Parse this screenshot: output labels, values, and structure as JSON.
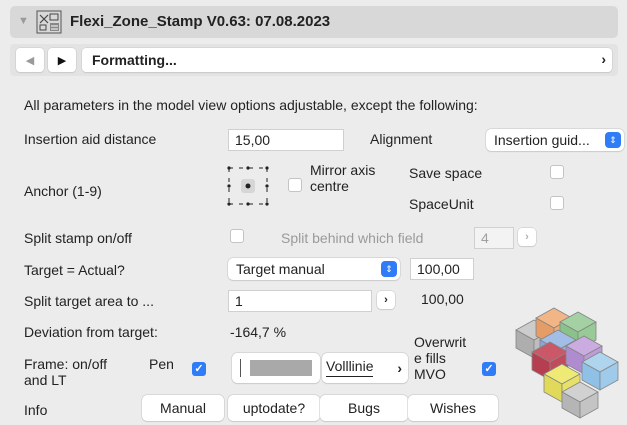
{
  "header": {
    "title": "Flexi_Zone_Stamp V0.63: 07.08.2023",
    "icon": "zone-stamp-object-icon",
    "collapse_icon": "disclosure-triangle-icon"
  },
  "nav": {
    "prev_icon": "triangle-left-icon",
    "next_icon": "triangle-right-icon",
    "page_label": "Formatting...",
    "page_chevron": "›"
  },
  "intro": "All parameters in the model view options adjustable, except the following:",
  "rows": {
    "insertion": {
      "label": "Insertion aid distance",
      "value": "15,00",
      "alignment_label": "Alignment",
      "alignment_value": "Insertion guid..."
    },
    "anchor": {
      "label": "Anchor (1-9)",
      "mirror_label_1": "Mirror axis",
      "mirror_label_2": "centre",
      "save_space_label": "Save space",
      "space_unit_label": "SpaceUnit"
    },
    "split": {
      "label": "Split stamp on/off",
      "behind_label": "Split behind which field",
      "behind_value": "4",
      "stepper": "›"
    },
    "target": {
      "label": "Target = Actual?",
      "select_value": "Target manual",
      "value": "100,00"
    },
    "split_target": {
      "label": "Split target area to ...",
      "value": "1",
      "stepper": "›",
      "result": "100,00"
    },
    "deviation": {
      "label": "Deviation from target:",
      "value": "-164,7 %"
    },
    "frame": {
      "label_1": "Frame: on/off",
      "label_2": "and LT",
      "pen_label": "Pen",
      "line_type": "Volllinie",
      "line_chevron": "›",
      "overwrite_1": "Overwrit",
      "overwrite_2": "e fills",
      "overwrite_3": "MVO"
    },
    "info": {
      "label": "Info",
      "buttons": [
        "Manual",
        "uptodate?",
        "Bugs",
        "Wishes"
      ]
    }
  },
  "colors": {
    "accent": "#2f7cf6",
    "header_bg": "#d8d8d8",
    "panel_bg": "#ececec"
  },
  "preview_icon": "stacked-cubes-preview"
}
